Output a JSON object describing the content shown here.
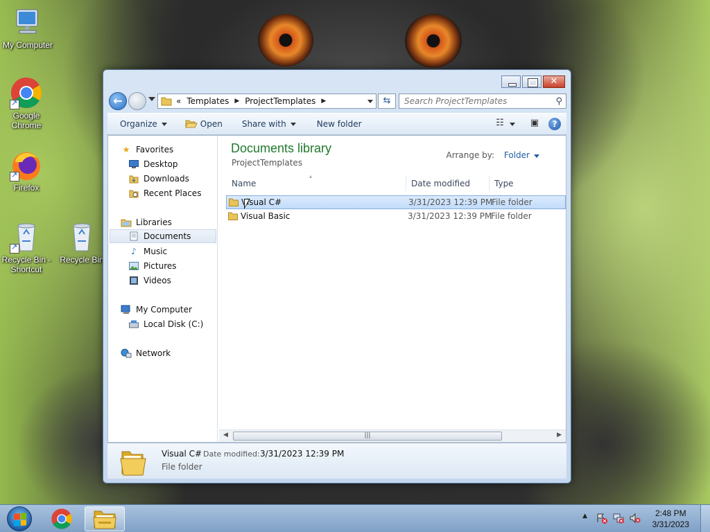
{
  "desktop": {
    "icons": [
      {
        "label": "My Computer",
        "icon": "computer-icon"
      },
      {
        "label": "Google Chrome",
        "icon": "chrome-icon"
      },
      {
        "label": "Firefox",
        "icon": "firefox-icon"
      },
      {
        "label": "Recycle Bin - Shortcut",
        "icon": "recycle-bin-icon"
      },
      {
        "label": "Recycle Bin",
        "icon": "recycle-bin-icon"
      }
    ]
  },
  "window": {
    "address": {
      "overflow": "«",
      "segments": [
        "Templates",
        "ProjectTemplates"
      ]
    },
    "search_placeholder": "Search ProjectTemplates",
    "toolbar": {
      "organize": "Organize",
      "open": "Open",
      "share_with": "Share with",
      "new_folder": "New folder"
    },
    "nav_pane": {
      "favorites": {
        "label": "Favorites",
        "items": [
          "Desktop",
          "Downloads",
          "Recent Places"
        ]
      },
      "libraries": {
        "label": "Libraries",
        "items": [
          "Documents",
          "Music",
          "Pictures",
          "Videos"
        ]
      },
      "computer": {
        "label": "My Computer",
        "items": [
          "Local Disk (C:)"
        ]
      },
      "network": {
        "label": "Network"
      }
    },
    "main": {
      "library_title": "Documents library",
      "library_subtitle": "ProjectTemplates",
      "arrange_label": "Arrange by:",
      "arrange_value": "Folder",
      "columns": {
        "name": "Name",
        "date": "Date modified",
        "type": "Type"
      },
      "rows": [
        {
          "name": "Visual C#",
          "date": "3/31/2023 12:39 PM",
          "type": "File folder",
          "selected": true
        },
        {
          "name": "Visual Basic",
          "date": "3/31/2023 12:39 PM",
          "type": "File folder",
          "selected": false
        }
      ]
    },
    "details": {
      "name": "Visual C#",
      "date_label": "Date modified:",
      "date_value": "3/31/2023 12:39 PM",
      "type": "File folder"
    }
  },
  "taskbar": {
    "time": "2:48 PM",
    "date": "3/31/2023"
  },
  "colors": {
    "accent": "#1f5ea8",
    "library_title": "#1f7a2c",
    "selection": "#c1dcfb"
  }
}
